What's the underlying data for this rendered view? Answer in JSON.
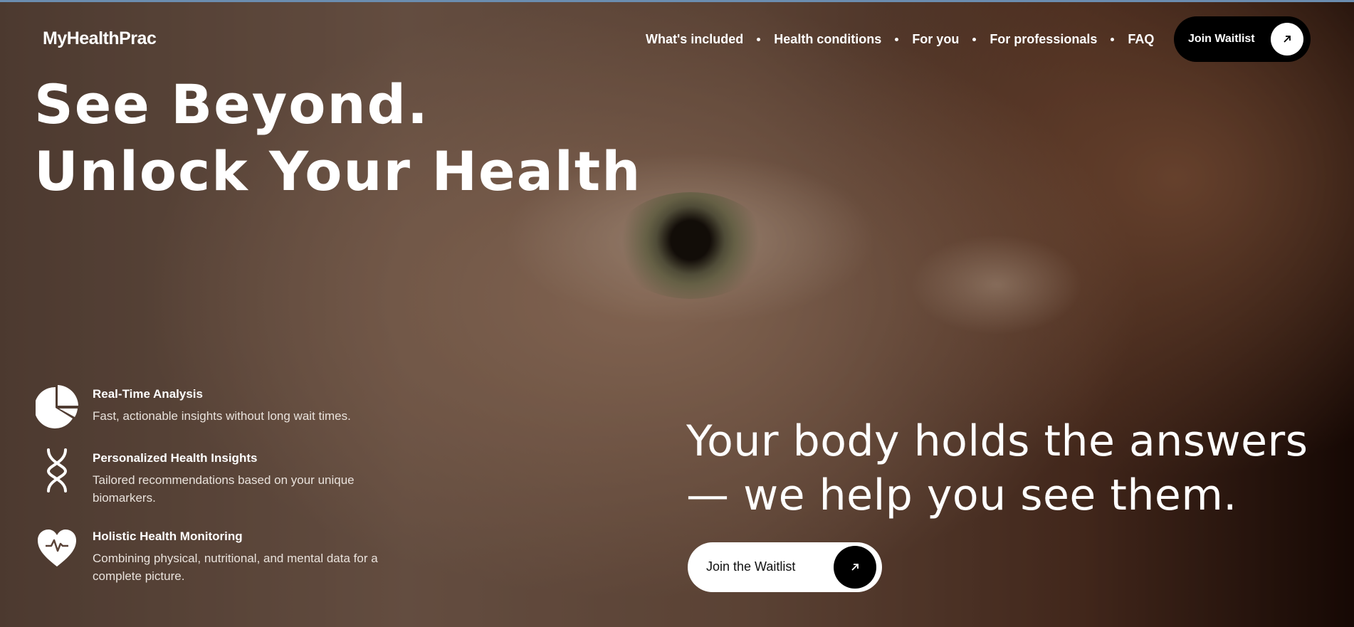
{
  "brand": {
    "name": "MyHealthPrac"
  },
  "nav": {
    "items": [
      {
        "label": "What's included"
      },
      {
        "label": "Health conditions"
      },
      {
        "label": "For you"
      },
      {
        "label": "For professionals"
      },
      {
        "label": "FAQ"
      }
    ],
    "cta_label": "Join Waitlist",
    "cta_icon": "arrow-up-right-icon"
  },
  "hero": {
    "headline_line1": "See Beyond.",
    "headline_line2": "Unlock Your Health",
    "tagline": "Your body holds the answers — we help you see them.",
    "cta_label": "Join the Waitlist",
    "cta_icon": "arrow-up-right-icon"
  },
  "features": [
    {
      "icon": "pie-chart-icon",
      "title": "Real-Time Analysis",
      "description": "Fast, actionable insights without long wait times."
    },
    {
      "icon": "dna-icon",
      "title": "Personalized Health Insights",
      "description": "Tailored recommendations based on your unique biomarkers."
    },
    {
      "icon": "heart-pulse-icon",
      "title": "Holistic Health Monitoring",
      "description": "Combining physical, nutritional, and mental data for a complete picture."
    }
  ],
  "colors": {
    "text": "#ffffff",
    "button_dark": "#000000",
    "button_light": "#ffffff"
  }
}
